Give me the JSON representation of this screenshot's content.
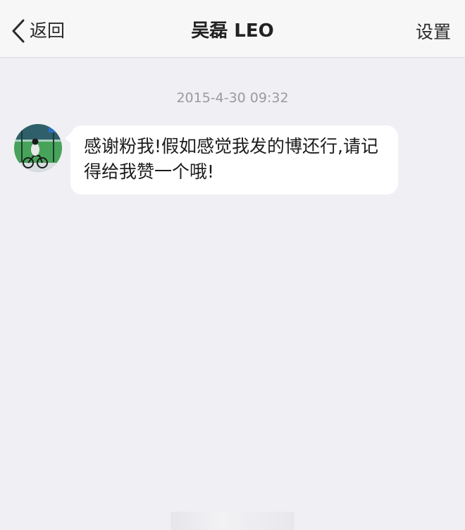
{
  "nav": {
    "back_label": "返回",
    "title": "吴磊 LEO",
    "settings_label": "设置"
  },
  "conversation": {
    "timestamp": "2015-4-30 09:32",
    "messages": [
      {
        "sender": "吴磊 LEO",
        "text": "感谢粉我!假如感觉我发的博还行,请记得给我赞一个哦!"
      }
    ]
  },
  "colors": {
    "background": "#efeff4",
    "nav_background": "#f7f7f8",
    "bubble": "#ffffff",
    "timestamp": "#9b9b9b"
  },
  "icons": {
    "back": "chevron-left-icon"
  }
}
